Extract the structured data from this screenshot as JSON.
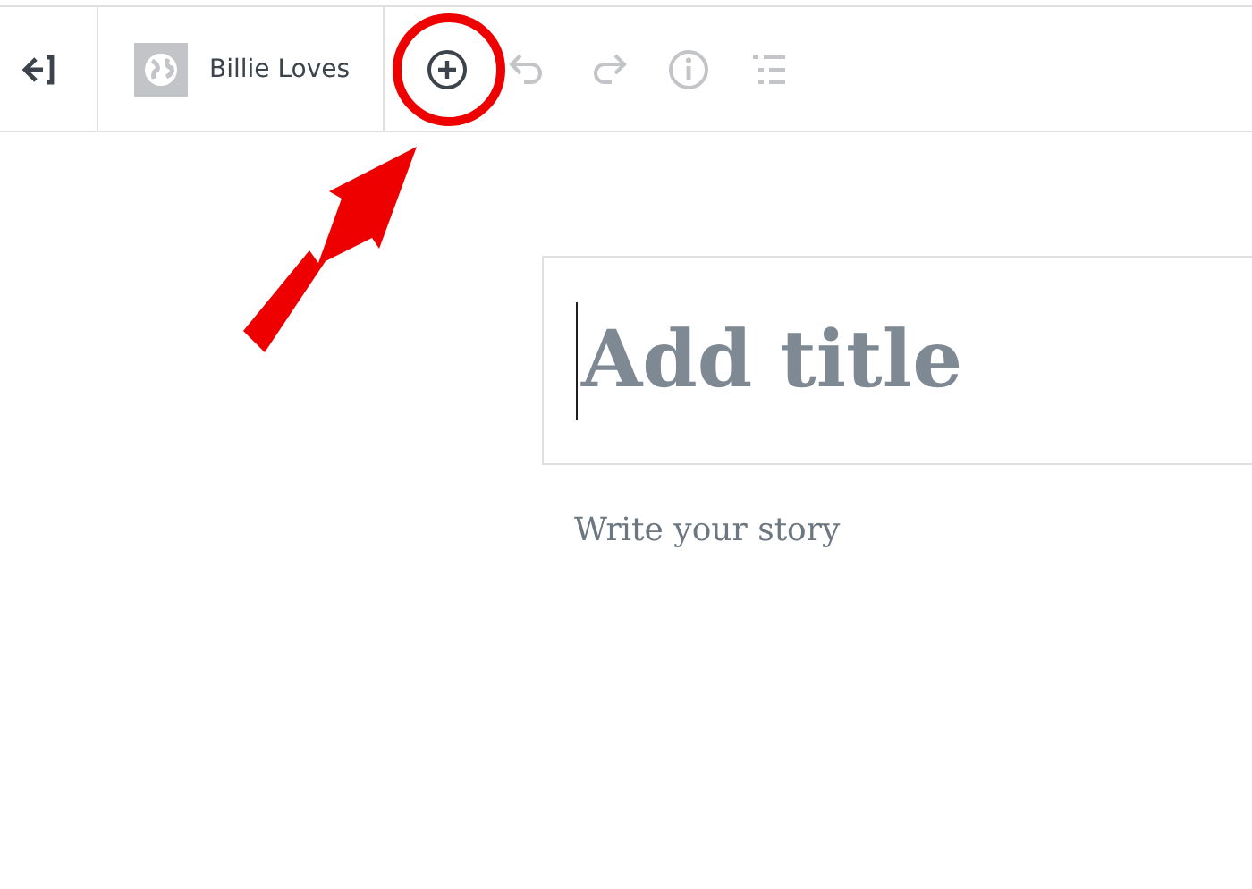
{
  "toolbar": {
    "site_name": "Billie Loves",
    "tools": [
      {
        "kind": "add",
        "disabled": false
      },
      {
        "kind": "undo",
        "disabled": true
      },
      {
        "kind": "redo",
        "disabled": true
      },
      {
        "kind": "info",
        "disabled": true
      },
      {
        "kind": "outline",
        "disabled": true
      }
    ]
  },
  "editor": {
    "title_placeholder": "Add title",
    "body_placeholder": "Write your story"
  }
}
